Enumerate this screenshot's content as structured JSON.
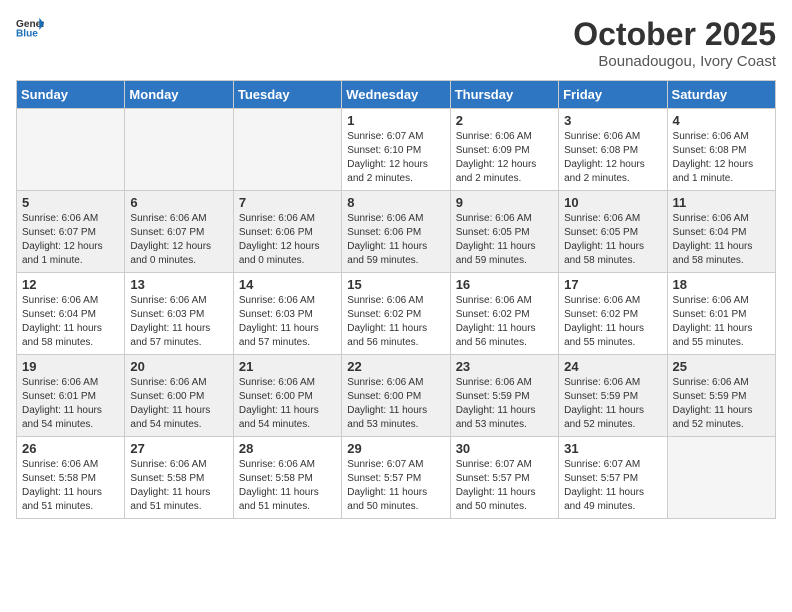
{
  "logo": {
    "general": "General",
    "blue": "Blue"
  },
  "title": "October 2025",
  "location": "Bounadougou, Ivory Coast",
  "weekdays": [
    "Sunday",
    "Monday",
    "Tuesday",
    "Wednesday",
    "Thursday",
    "Friday",
    "Saturday"
  ],
  "weeks": [
    [
      {
        "day": "",
        "info": ""
      },
      {
        "day": "",
        "info": ""
      },
      {
        "day": "",
        "info": ""
      },
      {
        "day": "1",
        "info": "Sunrise: 6:07 AM\nSunset: 6:10 PM\nDaylight: 12 hours and 2 minutes."
      },
      {
        "day": "2",
        "info": "Sunrise: 6:06 AM\nSunset: 6:09 PM\nDaylight: 12 hours and 2 minutes."
      },
      {
        "day": "3",
        "info": "Sunrise: 6:06 AM\nSunset: 6:08 PM\nDaylight: 12 hours and 2 minutes."
      },
      {
        "day": "4",
        "info": "Sunrise: 6:06 AM\nSunset: 6:08 PM\nDaylight: 12 hours and 1 minute."
      }
    ],
    [
      {
        "day": "5",
        "info": "Sunrise: 6:06 AM\nSunset: 6:07 PM\nDaylight: 12 hours and 1 minute."
      },
      {
        "day": "6",
        "info": "Sunrise: 6:06 AM\nSunset: 6:07 PM\nDaylight: 12 hours and 0 minutes."
      },
      {
        "day": "7",
        "info": "Sunrise: 6:06 AM\nSunset: 6:06 PM\nDaylight: 12 hours and 0 minutes."
      },
      {
        "day": "8",
        "info": "Sunrise: 6:06 AM\nSunset: 6:06 PM\nDaylight: 11 hours and 59 minutes."
      },
      {
        "day": "9",
        "info": "Sunrise: 6:06 AM\nSunset: 6:05 PM\nDaylight: 11 hours and 59 minutes."
      },
      {
        "day": "10",
        "info": "Sunrise: 6:06 AM\nSunset: 6:05 PM\nDaylight: 11 hours and 58 minutes."
      },
      {
        "day": "11",
        "info": "Sunrise: 6:06 AM\nSunset: 6:04 PM\nDaylight: 11 hours and 58 minutes."
      }
    ],
    [
      {
        "day": "12",
        "info": "Sunrise: 6:06 AM\nSunset: 6:04 PM\nDaylight: 11 hours and 58 minutes."
      },
      {
        "day": "13",
        "info": "Sunrise: 6:06 AM\nSunset: 6:03 PM\nDaylight: 11 hours and 57 minutes."
      },
      {
        "day": "14",
        "info": "Sunrise: 6:06 AM\nSunset: 6:03 PM\nDaylight: 11 hours and 57 minutes."
      },
      {
        "day": "15",
        "info": "Sunrise: 6:06 AM\nSunset: 6:02 PM\nDaylight: 11 hours and 56 minutes."
      },
      {
        "day": "16",
        "info": "Sunrise: 6:06 AM\nSunset: 6:02 PM\nDaylight: 11 hours and 56 minutes."
      },
      {
        "day": "17",
        "info": "Sunrise: 6:06 AM\nSunset: 6:02 PM\nDaylight: 11 hours and 55 minutes."
      },
      {
        "day": "18",
        "info": "Sunrise: 6:06 AM\nSunset: 6:01 PM\nDaylight: 11 hours and 55 minutes."
      }
    ],
    [
      {
        "day": "19",
        "info": "Sunrise: 6:06 AM\nSunset: 6:01 PM\nDaylight: 11 hours and 54 minutes."
      },
      {
        "day": "20",
        "info": "Sunrise: 6:06 AM\nSunset: 6:00 PM\nDaylight: 11 hours and 54 minutes."
      },
      {
        "day": "21",
        "info": "Sunrise: 6:06 AM\nSunset: 6:00 PM\nDaylight: 11 hours and 54 minutes."
      },
      {
        "day": "22",
        "info": "Sunrise: 6:06 AM\nSunset: 6:00 PM\nDaylight: 11 hours and 53 minutes."
      },
      {
        "day": "23",
        "info": "Sunrise: 6:06 AM\nSunset: 5:59 PM\nDaylight: 11 hours and 53 minutes."
      },
      {
        "day": "24",
        "info": "Sunrise: 6:06 AM\nSunset: 5:59 PM\nDaylight: 11 hours and 52 minutes."
      },
      {
        "day": "25",
        "info": "Sunrise: 6:06 AM\nSunset: 5:59 PM\nDaylight: 11 hours and 52 minutes."
      }
    ],
    [
      {
        "day": "26",
        "info": "Sunrise: 6:06 AM\nSunset: 5:58 PM\nDaylight: 11 hours and 51 minutes."
      },
      {
        "day": "27",
        "info": "Sunrise: 6:06 AM\nSunset: 5:58 PM\nDaylight: 11 hours and 51 minutes."
      },
      {
        "day": "28",
        "info": "Sunrise: 6:06 AM\nSunset: 5:58 PM\nDaylight: 11 hours and 51 minutes."
      },
      {
        "day": "29",
        "info": "Sunrise: 6:07 AM\nSunset: 5:57 PM\nDaylight: 11 hours and 50 minutes."
      },
      {
        "day": "30",
        "info": "Sunrise: 6:07 AM\nSunset: 5:57 PM\nDaylight: 11 hours and 50 minutes."
      },
      {
        "day": "31",
        "info": "Sunrise: 6:07 AM\nSunset: 5:57 PM\nDaylight: 11 hours and 49 minutes."
      },
      {
        "day": "",
        "info": ""
      }
    ]
  ]
}
